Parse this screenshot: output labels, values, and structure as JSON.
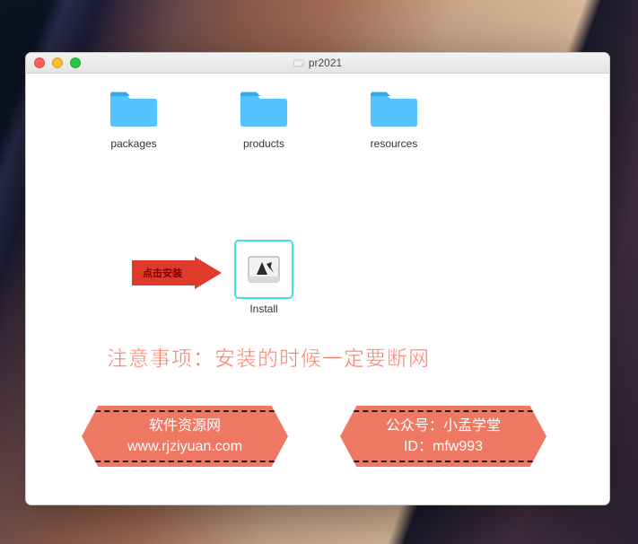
{
  "window": {
    "title": "pr2021"
  },
  "items": {
    "folder1": "packages",
    "folder2": "products",
    "folder3": "resources",
    "install": "Install"
  },
  "arrow_label": "点击安装",
  "notice": "注意事项：安装的时候一定要断网",
  "badge_left": {
    "line1": "软件资源网",
    "line2": "www.rjziyuan.com"
  },
  "badge_right": {
    "line1": "公众号：小孟学堂",
    "line2": "ID：mfw993"
  }
}
